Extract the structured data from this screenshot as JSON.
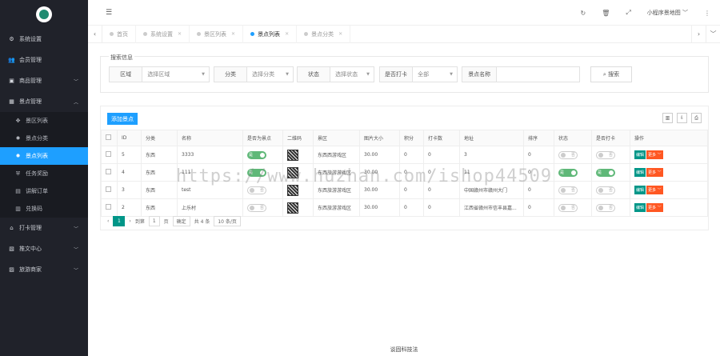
{
  "sidebar": {
    "items": [
      {
        "label": "系统设置",
        "icon": "gears-icon"
      },
      {
        "label": "会员管理",
        "icon": "users-icon"
      },
      {
        "label": "商品管理",
        "icon": "cart-icon"
      },
      {
        "label": "景点管理",
        "icon": "grid-icon"
      }
    ],
    "sub": [
      {
        "label": "景区列表",
        "icon": "cluster-icon"
      },
      {
        "label": "景点分类",
        "icon": "gear-icon"
      },
      {
        "label": "景点列表",
        "icon": "gear-icon"
      },
      {
        "label": "任务奖励",
        "icon": "shield-icon"
      },
      {
        "label": "讲解订单",
        "icon": "file-icon"
      },
      {
        "label": "兑换码",
        "icon": "barcode-icon"
      }
    ],
    "bottom": [
      {
        "label": "打卡管理",
        "icon": "bank-icon"
      },
      {
        "label": "推文中心",
        "icon": "doc-icon"
      },
      {
        "label": "旅游商家",
        "icon": "chart-icon"
      }
    ]
  },
  "header": {
    "user": "小程序景地图"
  },
  "tabs": [
    {
      "label": "首页"
    },
    {
      "label": "系统设置"
    },
    {
      "label": "景区列表"
    },
    {
      "label": "景点列表"
    },
    {
      "label": "景点分类"
    }
  ],
  "search": {
    "title": "搜索信息",
    "area_label": "区域",
    "area_value": "选择区域",
    "cat_label": "分类",
    "cat_value": "选择分类",
    "status_label": "状态",
    "status_value": "选择状态",
    "checkin_label": "是否打卡",
    "checkin_value": "全部",
    "name_label": "景点名称",
    "button": "搜索"
  },
  "table": {
    "add_button": "添加景点",
    "headers": [
      "ID",
      "分类",
      "名称",
      "是否为景点",
      "二维码",
      "景区",
      "图片大小",
      "积分",
      "打卡数",
      "地址",
      "排序",
      "状态",
      "是否打卡",
      "操作"
    ],
    "rows": [
      {
        "id": "5",
        "cat": "东西",
        "name": "3333",
        "is_spot": "是",
        "scenic": "东西西游戏区",
        "size": "30.00",
        "points": "0",
        "checkins": "0",
        "addr": "3",
        "sort": "0",
        "status": "否",
        "checkin": "否",
        "edit": "编辑",
        "more": "更多"
      },
      {
        "id": "4",
        "cat": "东西",
        "name": "111",
        "is_spot": "是",
        "scenic": "东西旅游游戏区",
        "size": "30.00",
        "points": "0",
        "checkins": "0",
        "addr": "11",
        "sort": "0",
        "status": "是",
        "checkin": "是",
        "edit": "编辑",
        "more": "更多"
      },
      {
        "id": "3",
        "cat": "东西",
        "name": "test",
        "is_spot": "否",
        "scenic": "东西旅游游戏区",
        "size": "30.00",
        "points": "0",
        "checkins": "0",
        "addr": "中国赣州市赣州大门",
        "sort": "0",
        "status": "否",
        "checkin": "否",
        "edit": "编辑",
        "more": "更多"
      },
      {
        "id": "2",
        "cat": "东西",
        "name": "上乐村",
        "is_spot": "否",
        "scenic": "东西旅游游戏区",
        "size": "30.00",
        "points": "0",
        "checkins": "0",
        "addr": "江西省赣州市信丰县嘉...",
        "sort": "0",
        "status": "否",
        "checkin": "否",
        "edit": "编辑",
        "more": "更多"
      }
    ]
  },
  "pager": {
    "current": "1",
    "goto_label": "到第",
    "page_input": "1",
    "page_unit": "页",
    "confirm": "确定",
    "total": "共 4 条",
    "per_page": "10 条/页"
  },
  "footer": "谈固科技法",
  "watermark": "https://www.huzhan.com/ishop44509"
}
